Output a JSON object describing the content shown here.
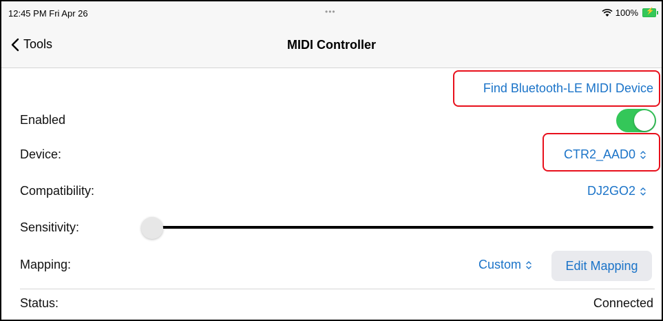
{
  "statusbar": {
    "time": "12:45 PM  Fri Apr 26",
    "dots": "•••",
    "battery": "100%"
  },
  "nav": {
    "back_label": "Tools",
    "title": "MIDI Controller"
  },
  "actions": {
    "find_device_label": "Find Bluetooth-LE MIDI Device"
  },
  "settings": {
    "enabled_label": "Enabled",
    "enabled_state": "on",
    "device_label": "Device:",
    "device_value": "CTR2_AAD0",
    "compatibility_label": "Compatibility:",
    "compatibility_value": "DJ2GO2",
    "sensitivity_label": "Sensitivity:",
    "sensitivity_level": 0,
    "mapping_label": "Mapping:",
    "mapping_value": "Custom",
    "edit_mapping_label": "Edit Mapping",
    "status_label": "Status:",
    "status_value": "Connected"
  },
  "colors": {
    "accent": "#1a73c8",
    "toggle_on": "#34c759",
    "highlight": "#e8101c"
  }
}
